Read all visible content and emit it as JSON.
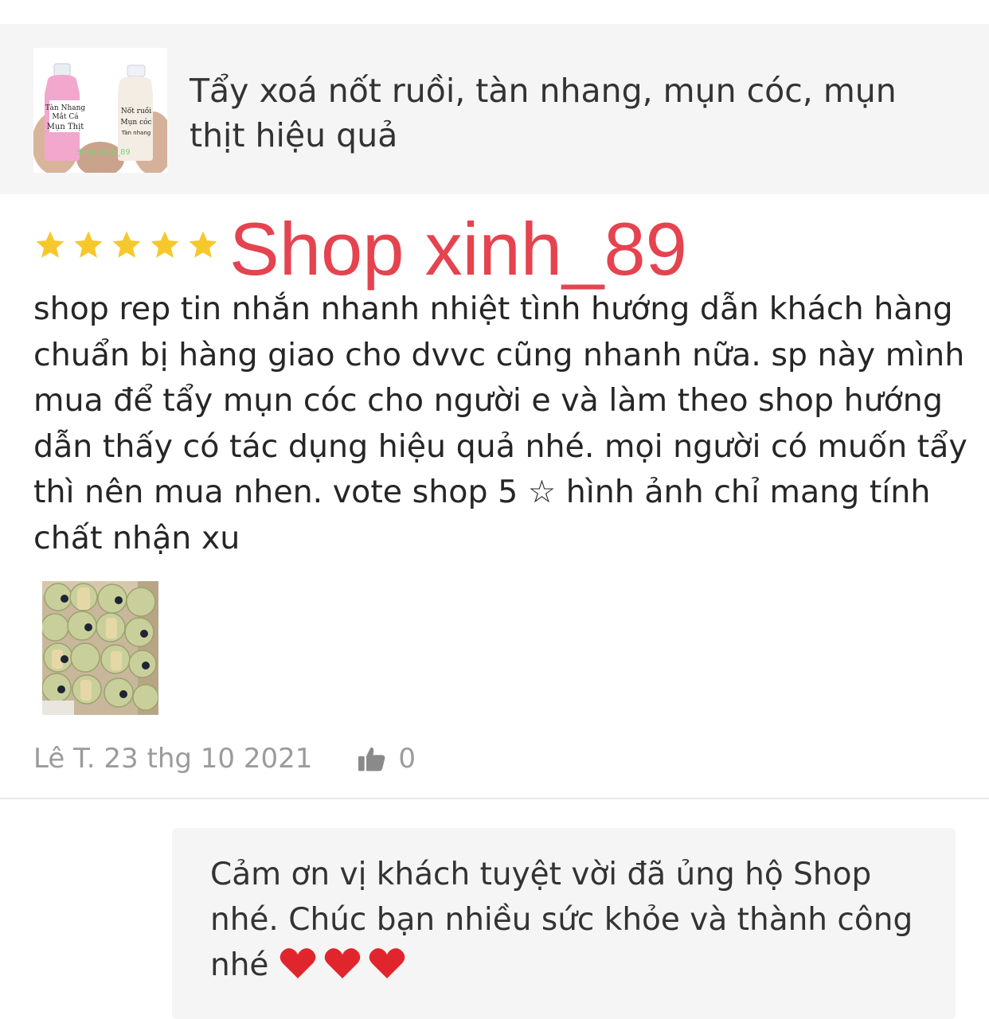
{
  "product": {
    "title": "Tẩy xoá nốt ruồi, tàn nhang, mụn cóc, mụn thịt hiệu quả",
    "thumb_left_bottle_label": "Tàn Nhang Mắt Cá Mụn Thịt",
    "thumb_right_bottle_label": "Nốt ruồi Mụn cóc Tàn nhang",
    "thumb_watermark": "Shop xinh_89"
  },
  "review": {
    "rating": 5,
    "rating_max": 5,
    "star_color": "#f6c82b",
    "shop_watermark": "Shop xinh_89",
    "watermark_color": "#e5434f",
    "text": "shop rep tin nhắn nhanh nhiệt tình hướng dẫn khách hàng chuẩn bị hàng giao cho dvvc cũng nhanh nữa. sp này mình mua để tẩy mụn cóc cho người e và làm theo shop hướng dẫn thấy có tác dụng hiệu quả nhé. mọi người có muốn tẩy thì nên mua nhen. vote shop 5 ☆ hình ảnh chỉ mang tính chất nhận xu",
    "author_date": "Lê T. 23 thg 10 2021",
    "likes": "0",
    "like_icon": "thumbs-up-icon"
  },
  "reply": {
    "text": "Cảm ơn vị khách tuyệt vời đã ủng hộ Shop nhé. Chúc bạn nhiều sức khỏe và thành công nhé",
    "hearts": 3,
    "heart_icon": "heart-icon"
  }
}
